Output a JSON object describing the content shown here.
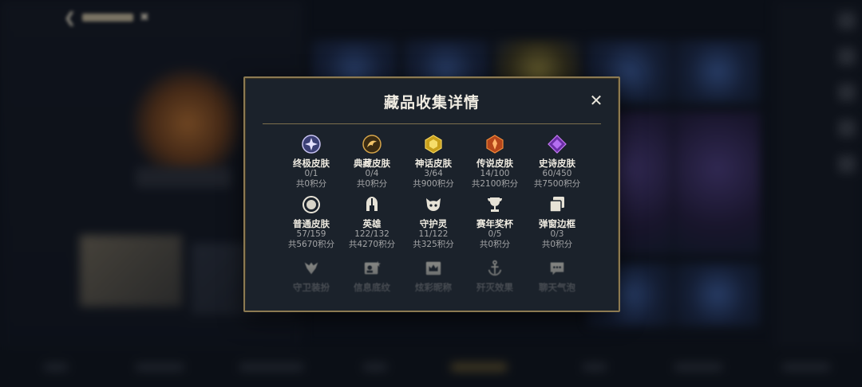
{
  "background": {
    "colors": {
      "accent_gold": "#8c7a52",
      "panel": "#1b222b"
    }
  },
  "modal": {
    "title": "藏品收集详情",
    "close_icon": "close-icon",
    "rows": [
      [
        {
          "icon": "ultimate-skin-icon",
          "label": "终极皮肤",
          "count": "0/1",
          "points": "共0积分"
        },
        {
          "icon": "collector-skin-icon",
          "label": "典藏皮肤",
          "count": "0/4",
          "points": "共0积分"
        },
        {
          "icon": "mythic-skin-icon",
          "label": "神话皮肤",
          "count": "3/64",
          "points": "共900积分"
        },
        {
          "icon": "legendary-skin-icon",
          "label": "传说皮肤",
          "count": "14/100",
          "points": "共2100积分"
        },
        {
          "icon": "epic-skin-icon",
          "label": "史诗皮肤",
          "count": "60/450",
          "points": "共7500积分"
        }
      ],
      [
        {
          "icon": "normal-skin-icon",
          "label": "普通皮肤",
          "count": "57/159",
          "points": "共5670积分"
        },
        {
          "icon": "hero-helmet-icon",
          "label": "英雄",
          "count": "122/132",
          "points": "共4270积分"
        },
        {
          "icon": "guardian-spirit-icon",
          "label": "守护灵",
          "count": "11/122",
          "points": "共325积分"
        },
        {
          "icon": "season-trophy-icon",
          "label": "赛年奖杯",
          "count": "0/5",
          "points": "共0积分"
        },
        {
          "icon": "barrage-frame-icon",
          "label": "弹窗边框",
          "count": "0/3",
          "points": "共0积分"
        }
      ],
      [
        {
          "icon": "guardian-outfit-icon",
          "label": "守卫装扮"
        },
        {
          "icon": "profile-card-icon",
          "label": "信息底纹"
        },
        {
          "icon": "crown-title-icon",
          "label": "炫彩昵称"
        },
        {
          "icon": "anchor-effect-icon",
          "label": "歼灭效果"
        },
        {
          "icon": "chat-bubble-icon",
          "label": "聊天气泡"
        }
      ]
    ]
  }
}
